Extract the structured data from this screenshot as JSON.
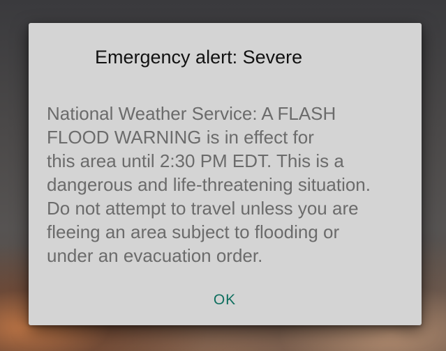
{
  "alert_dialog": {
    "title": "Emergency alert: Severe",
    "message_lines": [
      "National Weather Service: A FLASH",
      "FLOOD WARNING is in effect for",
      "this area until 2:30 PM EDT. This is a",
      "dangerous and life-threatening situation.",
      "Do not attempt to travel unless you are",
      "fleeing an area subject to flooding or",
      "under an evacuation order."
    ],
    "ok_label": "OK"
  },
  "colors": {
    "dialog_background": "#d4d4d4",
    "title_text": "#111111",
    "body_text": "#6b6b6b",
    "accent": "#0f6f5f"
  }
}
